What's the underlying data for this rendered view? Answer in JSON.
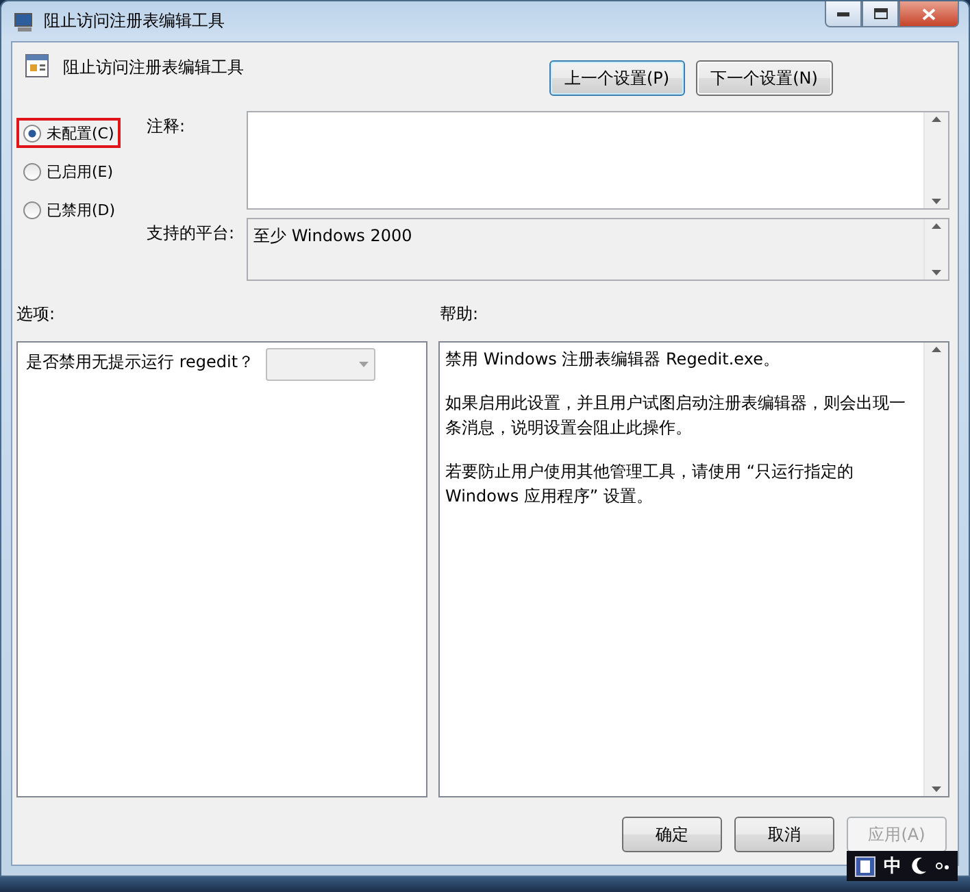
{
  "window": {
    "title": "阻止访问注册表编辑工具"
  },
  "policy": {
    "title": "阻止访问注册表编辑工具"
  },
  "nav_buttons": [
    {
      "label": "上一个设置(P)",
      "focused": true
    },
    {
      "label": "下一个设置(N)",
      "focused": false
    }
  ],
  "states": [
    {
      "label": "未配置(C)",
      "selected": true,
      "highlighted": true
    },
    {
      "label": "已启用(E)",
      "selected": false,
      "highlighted": false
    },
    {
      "label": "已禁用(D)",
      "selected": false,
      "highlighted": false
    }
  ],
  "comment": {
    "label": "注释:"
  },
  "platform": {
    "label": "支持的平台:",
    "value": "至少 Windows 2000"
  },
  "options": {
    "label": "选项:",
    "question": "是否禁用无提示运行 regedit？",
    "dropdown_disabled": true
  },
  "help": {
    "label": "帮助:",
    "paragraphs": [
      "禁用 Windows 注册表编辑器 Regedit.exe。",
      "如果启用此设置，并且用户试图启动注册表编辑器，则会出现一条消息，说明设置会阻止此操作。",
      "若要防止用户使用其他管理工具，请使用 “只运行指定的 Windows 应用程序” 设置。"
    ]
  },
  "buttons": [
    {
      "label": "确定",
      "disabled": false
    },
    {
      "label": "取消",
      "disabled": false
    },
    {
      "label": "应用(A)",
      "disabled": true
    }
  ],
  "ime": {
    "mode": "中"
  }
}
